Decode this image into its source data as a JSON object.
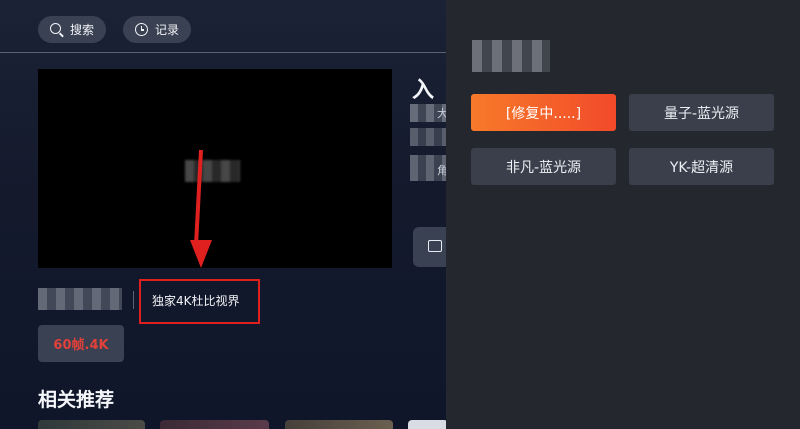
{
  "toolbar": {
    "search_label": "搜索",
    "history_label": "记录"
  },
  "detail": {
    "title_partial": "入",
    "meta_char_1": "大",
    "meta_char_2": "角",
    "exclusive_tag": "独家4K杜比视界",
    "quality_badge": "60帧.4K"
  },
  "section": {
    "recommend_title": "相关推荐"
  },
  "source_panel": {
    "sources": [
      {
        "label": "[修复中.....]",
        "active": true
      },
      {
        "label": "量子-蓝光源",
        "active": false
      },
      {
        "label": "非凡-蓝光源",
        "active": false
      },
      {
        "label": "YK-超清源",
        "active": false
      }
    ]
  },
  "colors": {
    "accent_red": "#e0201f",
    "active_gradient_start": "#f77a2a",
    "active_gradient_end": "#f24a2a",
    "quality_text": "#e0413a",
    "panel_bg": "#24272e"
  },
  "icons": [
    "search-icon",
    "clock-icon",
    "fullscreen-icon",
    "arrow-annotation"
  ]
}
